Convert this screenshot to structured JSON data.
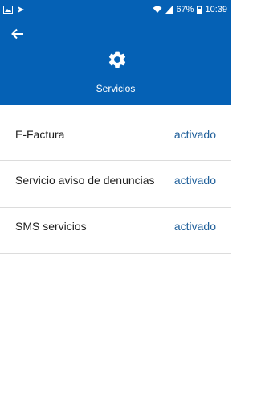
{
  "status_bar": {
    "battery_percent": "67%",
    "time": "10:39"
  },
  "header": {
    "back_icon": "arrow-left-icon",
    "page_icon": "gear-icon",
    "title": "Servicios",
    "background_color": "#0561b5"
  },
  "services": {
    "items": [
      {
        "label": "E-Factura",
        "status": "activado"
      },
      {
        "label": "Servicio aviso de denuncias",
        "status": "activado"
      },
      {
        "label": "SMS servicios",
        "status": "activado"
      }
    ],
    "status_color": "#1f5f9a"
  }
}
